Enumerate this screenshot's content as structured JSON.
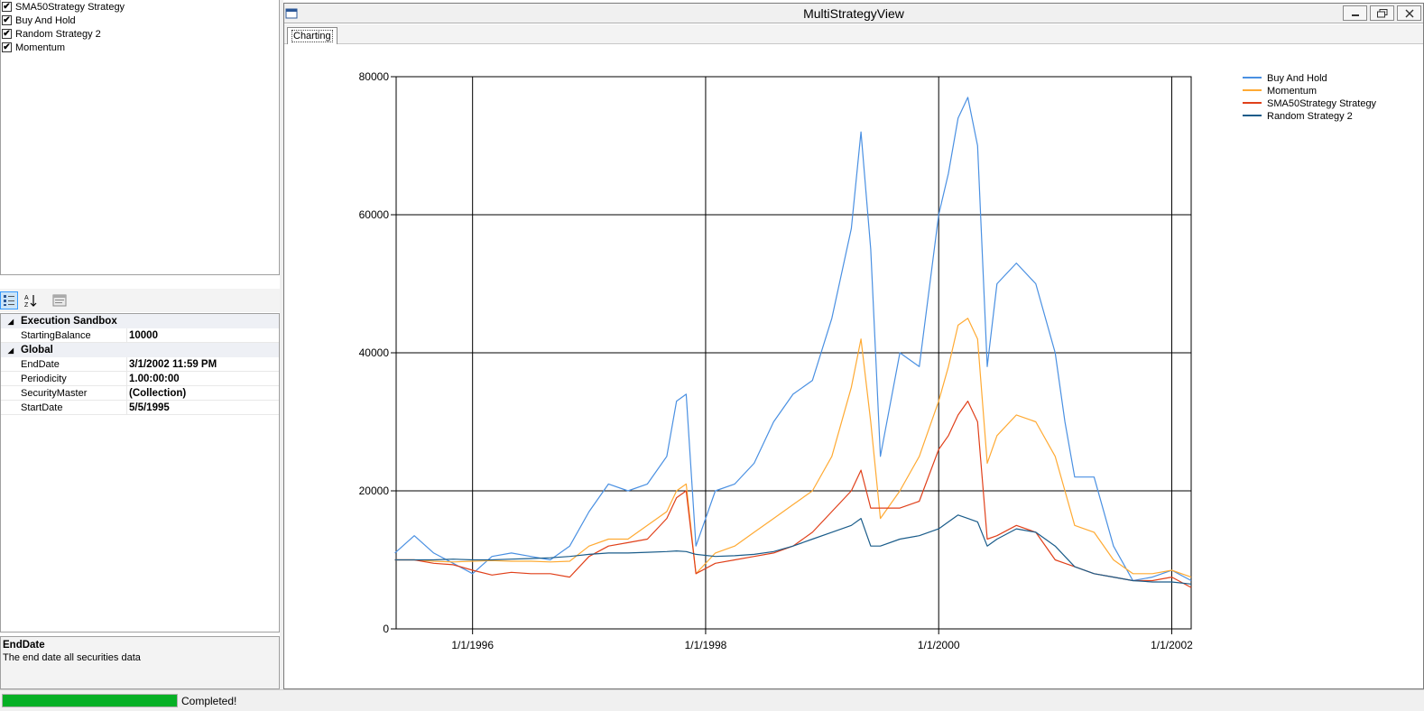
{
  "strategies": [
    {
      "label": "SMA50Strategy Strategy",
      "checked": true
    },
    {
      "label": "Buy And Hold",
      "checked": true
    },
    {
      "label": "Random Strategy 2",
      "checked": true
    },
    {
      "label": "Momentum",
      "checked": true
    }
  ],
  "toolbar": {
    "categorized_icon": "categorized-icon",
    "alphabetical_icon": "sort-az-icon",
    "property_pages_icon": "property-pages-icon"
  },
  "property_grid": {
    "categories": [
      {
        "name": "Execution Sandbox",
        "properties": [
          {
            "name": "StartingBalance",
            "value": "10000"
          }
        ]
      },
      {
        "name": "Global",
        "properties": [
          {
            "name": "EndDate",
            "value": "3/1/2002 11:59 PM"
          },
          {
            "name": "Periodicity",
            "value": "1.00:00:00"
          },
          {
            "name": "SecurityMaster",
            "value": "(Collection)"
          },
          {
            "name": "StartDate",
            "value": "5/5/1995"
          }
        ]
      }
    ]
  },
  "description": {
    "title": "EndDate",
    "text": "The end date all securities data"
  },
  "window": {
    "title": "MultiStrategyView",
    "tab": "Charting"
  },
  "status": {
    "progress_percent": 100,
    "text": "Completed!",
    "progress_color": "#06b025"
  },
  "chart_data": {
    "type": "line",
    "title": "",
    "xlabel": "",
    "ylabel": "",
    "xlim": [
      "1995-05-05",
      "2002-03-01"
    ],
    "ylim": [
      0,
      80000
    ],
    "x_ticks": [
      "1/1/1996",
      "1/1/1998",
      "1/1/2000",
      "1/1/2002"
    ],
    "y_ticks": [
      0,
      20000,
      40000,
      60000,
      80000
    ],
    "grid": true,
    "legend_position": "top-right",
    "x": [
      "1995-05",
      "1995-07",
      "1995-09",
      "1995-11",
      "1996-01",
      "1996-03",
      "1996-05",
      "1996-07",
      "1996-09",
      "1996-11",
      "1997-01",
      "1997-03",
      "1997-05",
      "1997-07",
      "1997-09",
      "1997-10",
      "1997-11",
      "1997-12",
      "1998-02",
      "1998-04",
      "1998-06",
      "1998-08",
      "1998-10",
      "1998-12",
      "1999-02",
      "1999-04",
      "1999-05",
      "1999-06",
      "1999-07",
      "1999-09",
      "1999-11",
      "2000-01",
      "2000-02",
      "2000-03",
      "2000-04",
      "2000-05",
      "2000-06",
      "2000-07",
      "2000-09",
      "2000-11",
      "2001-01",
      "2001-02",
      "2001-03",
      "2001-05",
      "2001-07",
      "2001-09",
      "2001-11",
      "2002-01",
      "2002-03"
    ],
    "series": [
      {
        "name": "Buy And Hold",
        "color": "#4a90e2",
        "values": [
          11000,
          13500,
          11000,
          9500,
          8000,
          10500,
          11000,
          10500,
          10000,
          12000,
          17000,
          21000,
          20000,
          21000,
          25000,
          33000,
          34000,
          12000,
          20000,
          21000,
          24000,
          30000,
          34000,
          36000,
          45000,
          58000,
          72000,
          55000,
          25000,
          40000,
          38000,
          60000,
          66000,
          74000,
          77000,
          70000,
          38000,
          50000,
          53000,
          50000,
          40000,
          30000,
          22000,
          22000,
          12000,
          7000,
          7500,
          8500,
          7000
        ]
      },
      {
        "name": "Momentum",
        "color": "#ffaa33",
        "values": [
          10000,
          10000,
          9800,
          9700,
          9800,
          9900,
          9800,
          9800,
          9700,
          9800,
          12000,
          13000,
          13000,
          15000,
          17000,
          20000,
          21000,
          8000,
          11000,
          12000,
          14000,
          16000,
          18000,
          20000,
          25000,
          35000,
          42000,
          30000,
          16000,
          20000,
          25000,
          33000,
          38000,
          44000,
          45000,
          42000,
          24000,
          28000,
          31000,
          30000,
          25000,
          20000,
          15000,
          14000,
          10000,
          8000,
          8000,
          8500,
          7500
        ]
      },
      {
        "name": "SMA50Strategy Strategy",
        "color": "#e0401a",
        "values": [
          10000,
          10000,
          9500,
          9300,
          8500,
          7800,
          8200,
          8000,
          8000,
          7500,
          10500,
          12000,
          12500,
          13000,
          16000,
          19000,
          20000,
          8000,
          9500,
          10000,
          10500,
          11000,
          12000,
          14000,
          17000,
          20000,
          23000,
          17500,
          17500,
          17500,
          18500,
          26000,
          28000,
          31000,
          33000,
          30000,
          13000,
          13500,
          15000,
          14000,
          10000,
          9500,
          9000,
          8000,
          7500,
          7000,
          7000,
          7500,
          6000
        ]
      },
      {
        "name": "Random Strategy 2",
        "color": "#1a5c8a",
        "values": [
          10000,
          10000,
          10000,
          10100,
          10000,
          10000,
          10100,
          10200,
          10300,
          10500,
          10800,
          11000,
          11000,
          11100,
          11200,
          11300,
          11200,
          10800,
          10500,
          10600,
          10800,
          11200,
          12000,
          13000,
          14000,
          15000,
          16000,
          12000,
          12000,
          13000,
          13500,
          14500,
          15500,
          16500,
          16000,
          15500,
          12000,
          13000,
          14500,
          14000,
          12000,
          10500,
          9000,
          8000,
          7500,
          7000,
          6800,
          6800,
          6500
        ]
      }
    ]
  }
}
